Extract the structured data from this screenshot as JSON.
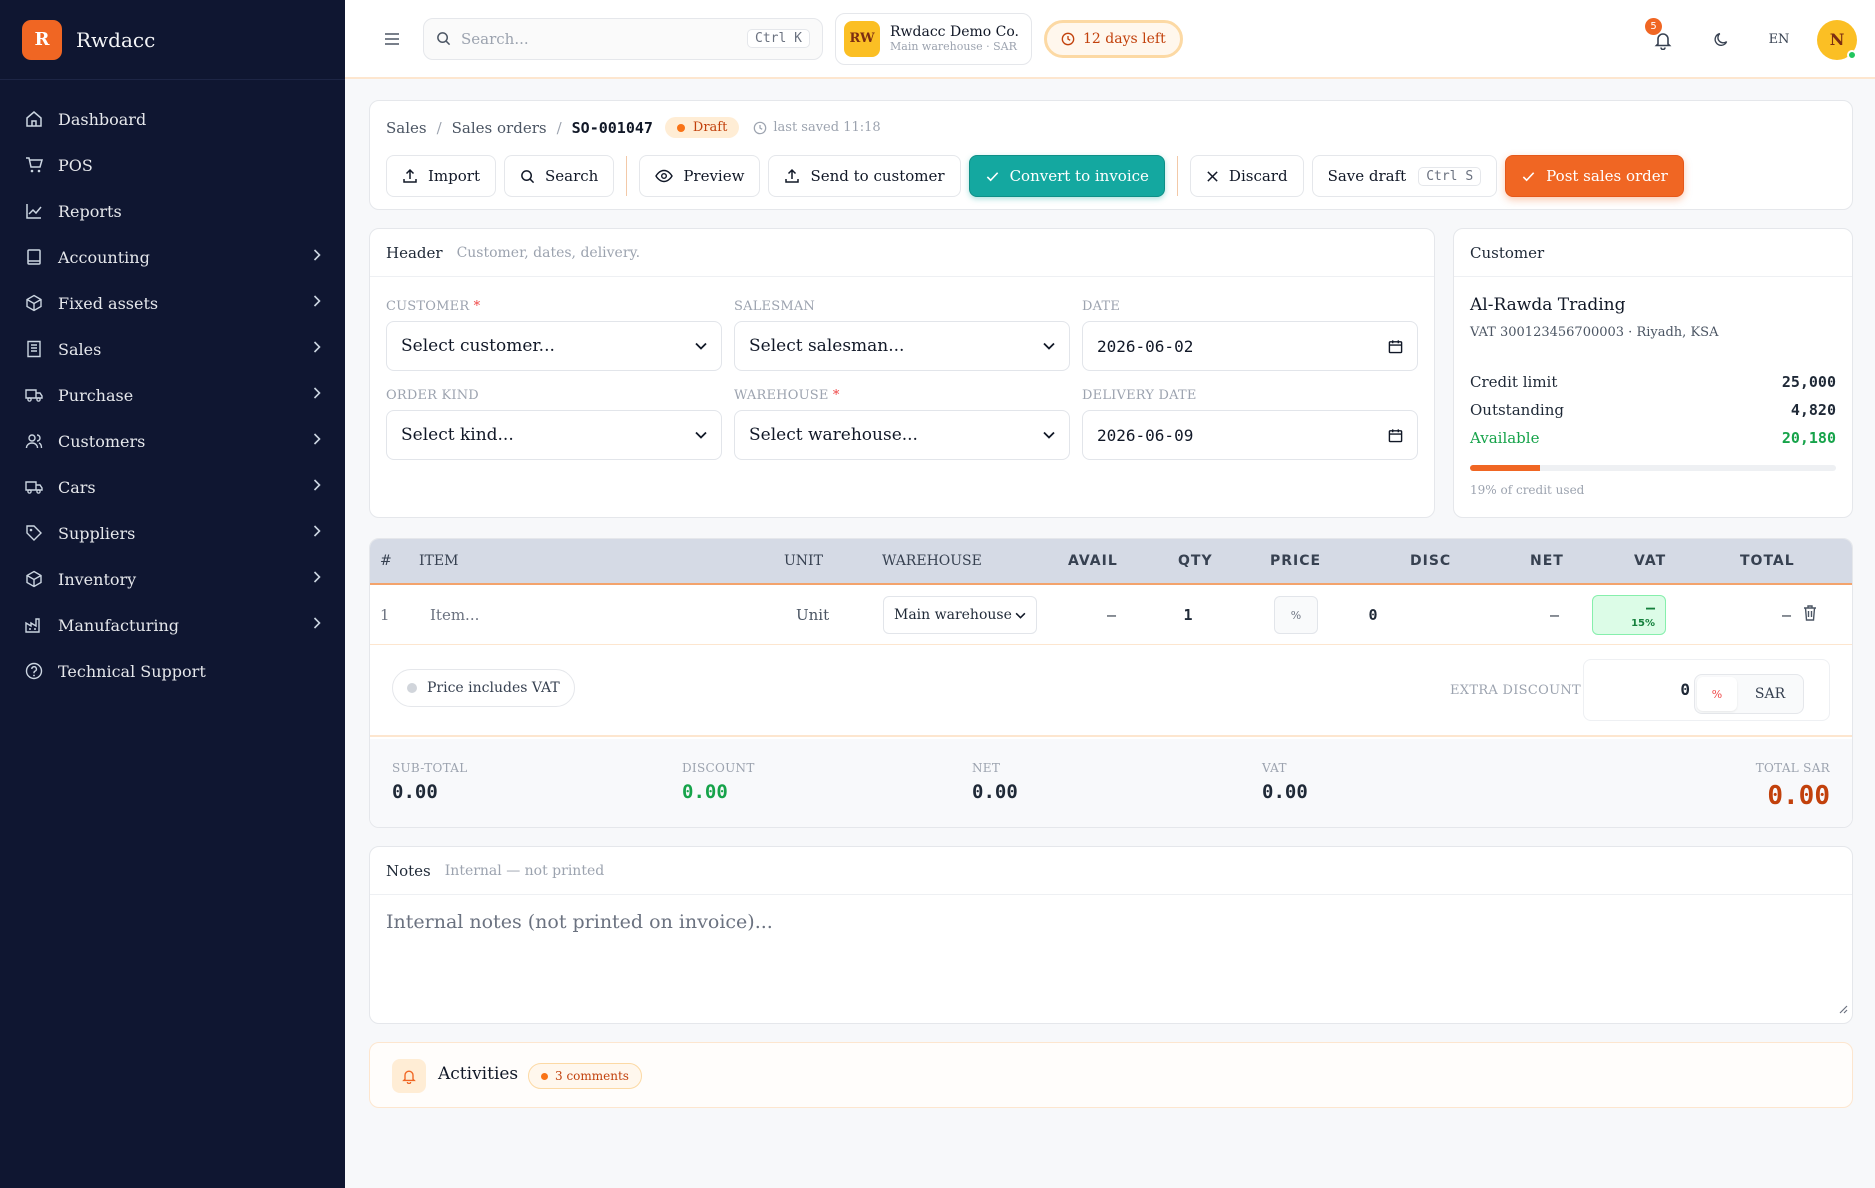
{
  "app": {
    "logo_letter": "R",
    "name": "Rwdacc"
  },
  "sidebar": {
    "items": [
      {
        "label": "Dashboard",
        "icon": "home-icon",
        "has_children": false
      },
      {
        "label": "POS",
        "icon": "cart-icon",
        "has_children": false
      },
      {
        "label": "Reports",
        "icon": "chart-line-icon",
        "has_children": false
      },
      {
        "label": "Accounting",
        "icon": "book-icon",
        "has_children": true
      },
      {
        "label": "Fixed assets",
        "icon": "box-icon",
        "has_children": true
      },
      {
        "label": "Sales",
        "icon": "receipt-icon",
        "has_children": true
      },
      {
        "label": "Purchase",
        "icon": "truck-icon",
        "has_children": true
      },
      {
        "label": "Customers",
        "icon": "users-icon",
        "has_children": true
      },
      {
        "label": "Cars",
        "icon": "truck-icon",
        "has_children": true
      },
      {
        "label": "Suppliers",
        "icon": "tag-icon",
        "has_children": true
      },
      {
        "label": "Inventory",
        "icon": "box-icon",
        "has_children": true
      },
      {
        "label": "Manufacturing",
        "icon": "factory-icon",
        "has_children": true
      },
      {
        "label": "Technical Support",
        "icon": "help-icon",
        "has_children": false
      }
    ]
  },
  "topbar": {
    "search_placeholder": "Search...",
    "search_shortcut": "Ctrl K",
    "company_initials": "RW",
    "company_name": "Rwdacc Demo Co.",
    "company_sub": "Main warehouse · SAR",
    "trial_days": "12",
    "trial_suffix": "days left",
    "notification_count": "5",
    "language": "EN",
    "user_initial": "N"
  },
  "page": {
    "breadcrumb": [
      "Sales",
      "Sales orders"
    ],
    "doc_number": "SO-001047",
    "status": "Draft",
    "last_saved": "last saved 11:18",
    "actions": {
      "import": "Import",
      "search": "Search",
      "preview": "Preview",
      "send": "Send to customer",
      "convert": "Convert to invoice",
      "discard": "Discard",
      "save_draft": "Save draft",
      "save_shortcut": "Ctrl S",
      "post": "Post sales order"
    }
  },
  "header_section": {
    "title": "Header",
    "subtitle": "Customer, dates, delivery.",
    "customer_label": "CUSTOMER",
    "customer_value": "Select customer...",
    "salesman_label": "SALESMAN",
    "salesman_value": "Select salesman...",
    "date_label": "DATE",
    "date_value": "2026-06-02",
    "order_kind_label": "ORDER KIND",
    "order_kind_value": "Select kind...",
    "warehouse_label": "WAREHOUSE",
    "warehouse_value": "Select warehouse...",
    "delivery_label": "DELIVERY DATE",
    "delivery_value": "2026-06-09"
  },
  "customer_panel": {
    "title": "Customer",
    "name": "Al-Rawda Trading",
    "vat_line": "VAT 300123456700003 · Riyadh, KSA",
    "credit_limit_label": "Credit limit",
    "credit_limit": "25,000",
    "outstanding_label": "Outstanding",
    "outstanding": "4,820",
    "available_label": "Available",
    "available": "20,180",
    "credit_used_fraction": 0.19,
    "credit_note": "19% of credit used"
  },
  "lines": {
    "columns": [
      "#",
      "ITEM",
      "UNIT",
      "WAREHOUSE",
      "AVAIL",
      "QTY",
      "PRICE",
      "DISC",
      "NET",
      "VAT",
      "TOTAL"
    ],
    "rows": [
      {
        "index": "1",
        "item": "Item...",
        "unit": "Unit",
        "warehouse": "Main warehouse",
        "avail": "—",
        "qty": "1",
        "price": "0",
        "disc": "0",
        "disc_type": "%",
        "net": "—",
        "vat": "—",
        "vat_rate": "15%",
        "total": "—"
      }
    ],
    "price_includes_vat": "Price includes VAT",
    "extra_discount_label": "EXTRA DISCOUNT",
    "extra_discount_value": "0",
    "extra_discount_pct": "%",
    "extra_discount_cur": "SAR"
  },
  "totals": {
    "subtotal_label": "SUB-TOTAL",
    "subtotal": "0.00",
    "discount_label": "DISCOUNT",
    "discount": "0.00",
    "net_label": "NET",
    "net": "0.00",
    "vat_label": "VAT",
    "vat": "0.00",
    "total_label": "TOTAL SAR",
    "total": "0.00"
  },
  "notes": {
    "title": "Notes",
    "subtitle": "Internal — not printed",
    "placeholder": "Internal notes (not printed on invoice)..."
  },
  "activities": {
    "title": "Activities",
    "comments": "3 comments"
  },
  "colors": {
    "sidebar_bg": "#0f1631",
    "accent": "#f06623",
    "teal": "#14a8a0",
    "success": "#16a34a"
  }
}
